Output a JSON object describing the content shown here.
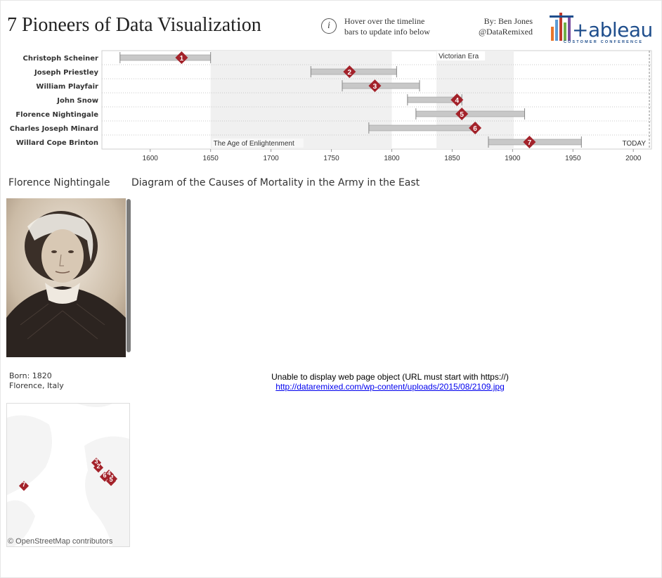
{
  "header": {
    "title": "7 Pioneers of Data Visualization",
    "hover_line1": "Hover over the timeline",
    "hover_line2": "bars to update info below",
    "byline1": "By: Ben Jones",
    "byline2": "@DataRemixed",
    "logo_word": "+ableau",
    "logo_sub": "CUSTOMER CONFERENCE"
  },
  "timeline": {
    "axis_range": [
      1560,
      2015
    ],
    "ticks": [
      1600,
      1650,
      1700,
      1750,
      1800,
      1850,
      1900,
      1950,
      2000
    ],
    "today_label": "TODAY",
    "eras": [
      {
        "label": "The Age of Enlightenment",
        "start": 1650,
        "end": 1800
      },
      {
        "label": "Victorian Era",
        "start": 1837,
        "end": 1901
      }
    ],
    "pioneers": [
      {
        "name": "Christoph Scheiner",
        "num": "1",
        "start": 1575,
        "end": 1650,
        "marker": 1626
      },
      {
        "name": "Joseph Priestley",
        "num": "2",
        "start": 1733,
        "end": 1804,
        "marker": 1765
      },
      {
        "name": "William Playfair",
        "num": "3",
        "start": 1759,
        "end": 1823,
        "marker": 1786
      },
      {
        "name": "John Snow",
        "num": "4",
        "start": 1813,
        "end": 1858,
        "marker": 1854
      },
      {
        "name": "Florence Nightingale",
        "num": "5",
        "start": 1820,
        "end": 1910,
        "marker": 1858
      },
      {
        "name": "Charles Joseph Minard",
        "num": "6",
        "start": 1781,
        "end": 1870,
        "marker": 1869
      },
      {
        "name": "Willard Cope Brinton",
        "num": "7",
        "start": 1880,
        "end": 1957,
        "marker": 1914
      }
    ]
  },
  "detail": {
    "person_name": "Florence Nightingale",
    "diagram_title": "Diagram of the Causes of Mortality in the Army in the East",
    "born_line1": "Born: 1820",
    "born_line2": "Florence, Italy",
    "web_error": "Unable to display web page object (URL must start with https://)",
    "web_link": "http://dataremixed.com/wp-content/uploads/2015/08/2109.jpg"
  },
  "map": {
    "credit": "© OpenStreetMap contributors",
    "markers": [
      "3",
      "2",
      "4",
      "6",
      "1",
      "5",
      "7"
    ]
  },
  "colors": {
    "marker": "#a3222a",
    "bar": "#c8c8c8",
    "era_band": "#f0f0f0",
    "logo_blue": "#1f4e8c"
  }
}
